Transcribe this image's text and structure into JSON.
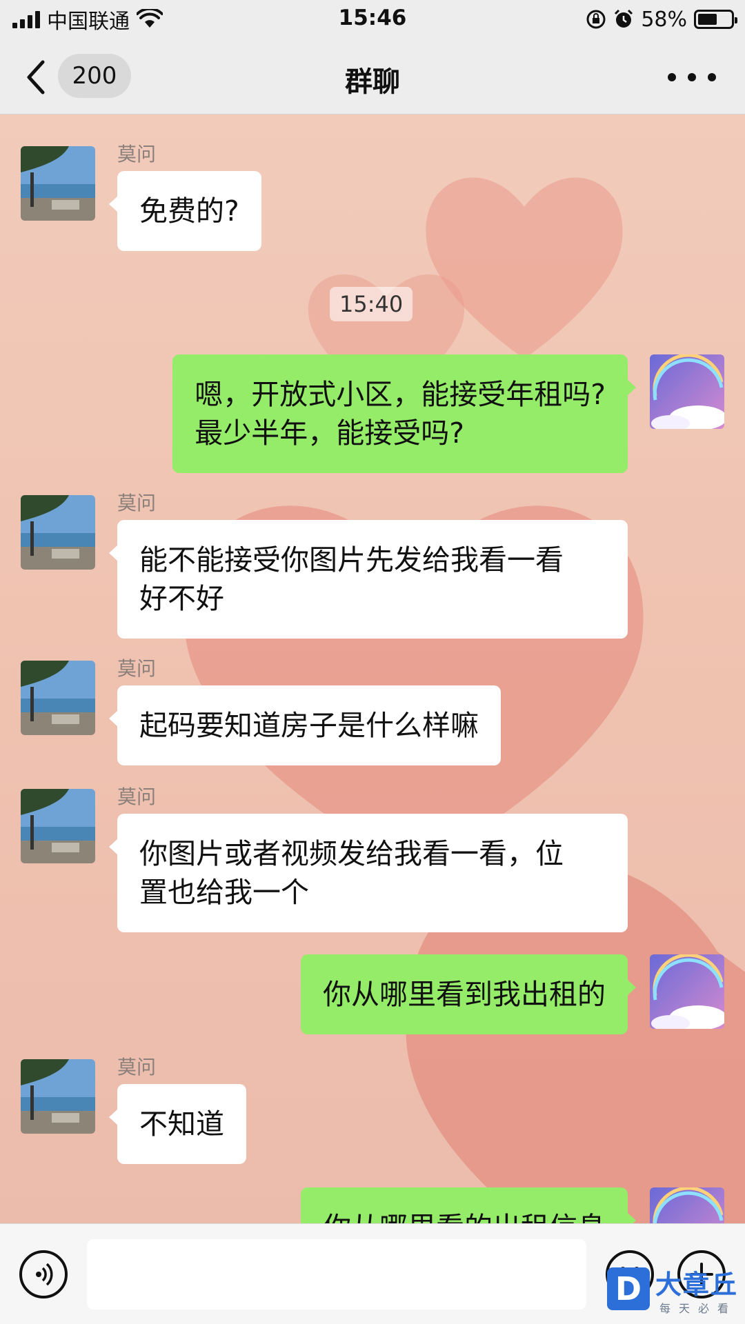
{
  "status_bar": {
    "carrier": "中国联通",
    "time": "15:46",
    "battery_percent": "58%",
    "battery_level": 0.58
  },
  "nav": {
    "unread_count": "200",
    "title": "群聊"
  },
  "chat": {
    "messages": [
      {
        "direction": "in",
        "sender": "莫问",
        "text": "免费的?"
      },
      {
        "type": "timestamp",
        "text": "15:40"
      },
      {
        "direction": "out",
        "text": "嗯，开放式小区，能接受年租吗?\n最少半年，能接受吗?"
      },
      {
        "direction": "in",
        "sender": "莫问",
        "text": "能不能接受你图片先发给我看一看\n好不好"
      },
      {
        "direction": "in",
        "sender": "莫问",
        "text": "起码要知道房子是什么样嘛"
      },
      {
        "direction": "in",
        "sender": "莫问",
        "text": "你图片或者视频发给我看一看，位\n置也给我一个"
      },
      {
        "direction": "out",
        "text": "你从哪里看到我出租的"
      },
      {
        "direction": "in",
        "sender": "莫问",
        "text": "不知道"
      },
      {
        "direction": "out",
        "text": "你从哪里看的出租信息"
      }
    ]
  },
  "input_bar": {
    "placeholder": ""
  },
  "icons": {
    "back": "chevron-left-icon",
    "more": "more-dots-icon",
    "voice": "voice-icon",
    "emoji": "emoji-icon",
    "plus": "plus-icon"
  },
  "watermark": {
    "logo_letter": "D",
    "title": "大章丘",
    "subtitle": "每天必看"
  },
  "colors": {
    "outgoing_bubble": "#95ec69",
    "incoming_bubble": "#ffffff",
    "chat_background": "#f0c4b2",
    "header": "#ededed"
  }
}
